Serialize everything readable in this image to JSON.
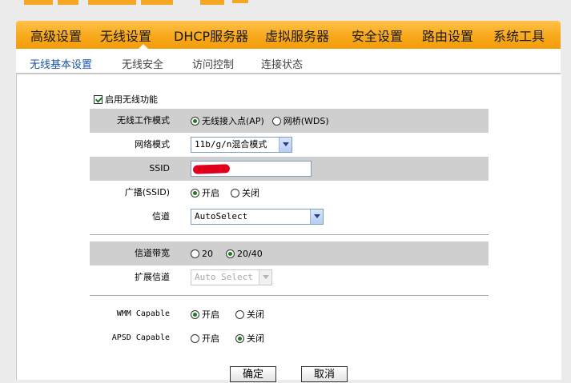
{
  "main_nav": {
    "items": [
      "高级设置",
      "无线设置",
      "DHCP服务器",
      "虚拟服务器",
      "安全设置",
      "路由设置",
      "系统工具"
    ],
    "active": "无线设置"
  },
  "sub_nav": {
    "tabs": [
      "无线基本设置",
      "无线安全",
      "访问控制",
      "连接状态"
    ],
    "active": "无线基本设置"
  },
  "form": {
    "enable_wireless": {
      "label": "启用无线功能",
      "checked": true
    },
    "work_mode": {
      "label": "无线工作模式",
      "options": [
        "无线接入点(AP)",
        "网桥(WDS)"
      ],
      "selected": "无线接入点(AP)"
    },
    "network_mode": {
      "label": "网络模式",
      "value": "11b/g/n混合模式"
    },
    "ssid": {
      "label": "SSID",
      "value": ""
    },
    "broadcast": {
      "label": "广播(SSID)",
      "options": [
        "开启",
        "关闭"
      ],
      "selected": "开启"
    },
    "channel": {
      "label": "信道",
      "value": "AutoSelect"
    },
    "bandwidth": {
      "label": "信道带宽",
      "options": [
        "20",
        "20/40"
      ],
      "selected": "20/40"
    },
    "ext_channel": {
      "label": "扩展信道",
      "value": "Auto Select",
      "disabled": true
    },
    "wmm": {
      "label": "WMM Capable",
      "options": [
        "开启",
        "关闭"
      ],
      "selected": "开启"
    },
    "apsd": {
      "label": "APSD Capable",
      "options": [
        "开启",
        "关闭"
      ],
      "selected": "关闭"
    }
  },
  "buttons": {
    "ok": "确定",
    "cancel": "取消"
  },
  "colors": {
    "nav_orange": "#f8a91b",
    "active_tab": "#1c55a6",
    "shaded_row": "#cfcfcf",
    "radio_dot": "#1b7d1b",
    "ssid_redaction": "#e0001b"
  }
}
